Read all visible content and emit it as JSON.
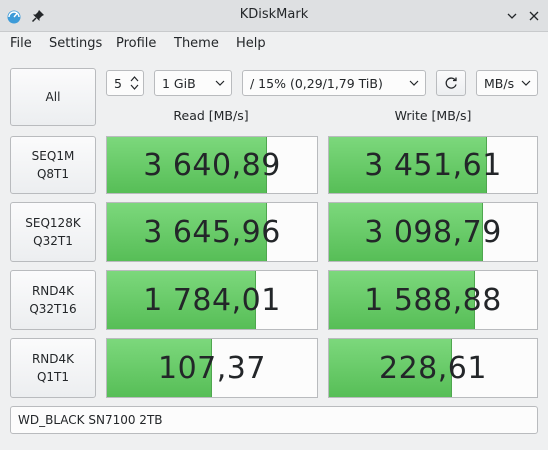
{
  "window": {
    "title": "KDiskMark"
  },
  "menu": [
    "File",
    "Settings",
    "Profile",
    "Theme",
    "Help"
  ],
  "controls": {
    "all_label": "All",
    "runs": "5",
    "size": "1 GiB",
    "target": "/ 15% (0,29/1,79 TiB)",
    "units": "MB/s"
  },
  "headers": {
    "read": "Read [MB/s]",
    "write": "Write [MB/s]"
  },
  "tests": [
    {
      "line1": "SEQ1M",
      "line2": "Q8T1",
      "read": "3 640,89",
      "read_fill": 0.76,
      "write": "3 451,61",
      "write_fill": 0.76
    },
    {
      "line1": "SEQ128K",
      "line2": "Q32T1",
      "read": "3 645,96",
      "read_fill": 0.76,
      "write": "3 098,79",
      "write_fill": 0.74
    },
    {
      "line1": "RND4K",
      "line2": "Q32T16",
      "read": "1 784,01",
      "read_fill": 0.71,
      "write": "1 588,88",
      "write_fill": 0.7
    },
    {
      "line1": "RND4K",
      "line2": "Q1T1",
      "read": "107,37",
      "read_fill": 0.5,
      "write": "228,61",
      "write_fill": 0.59
    }
  ],
  "comment": "WD_BLACK SN7100 2TB",
  "colors": {
    "bar_top": "#7cd87c",
    "bar_bottom": "#57be57",
    "titlebar": "#dee0e2",
    "window_bg": "#eff0f1"
  }
}
